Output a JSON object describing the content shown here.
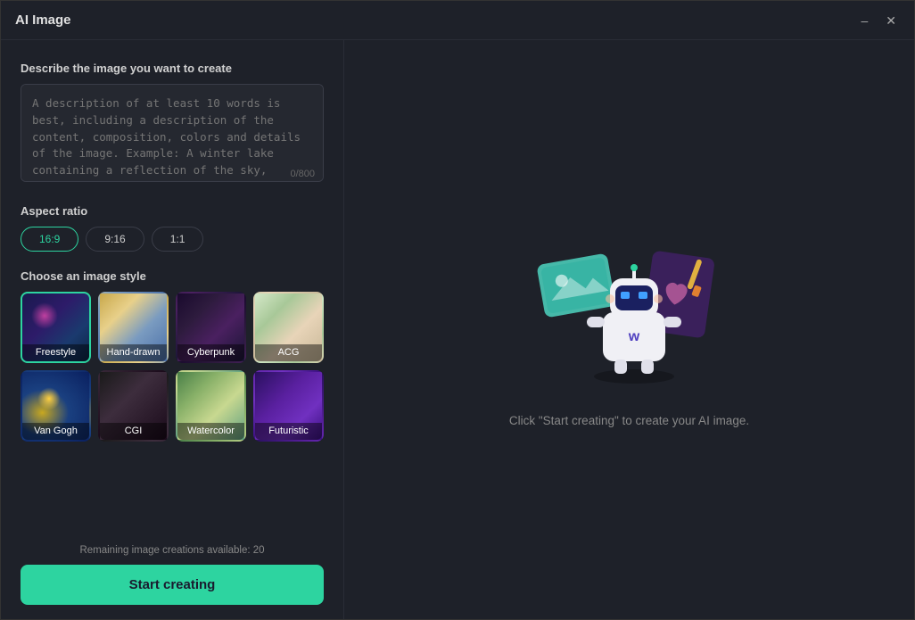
{
  "window": {
    "title": "AI Image",
    "minimize_label": "–",
    "close_label": "✕"
  },
  "left_panel": {
    "describe_label": "Describe the image you want to create",
    "textarea_placeholder": "A description of at least 10 words is best, including a description of the content, composition, colors and details of the image. Example: A winter lake containing a reflection of the sky, covered in white",
    "char_count": "0/800",
    "aspect_ratio_label": "Aspect ratio",
    "aspect_options": [
      {
        "id": "16_9",
        "label": "16:9",
        "active": true
      },
      {
        "id": "9_16",
        "label": "9:16",
        "active": false
      },
      {
        "id": "1_1",
        "label": "1:1",
        "active": false
      }
    ],
    "style_label": "Choose an image style",
    "styles": [
      {
        "id": "freestyle",
        "label": "Freestyle",
        "active": true,
        "class": "style-freestyle"
      },
      {
        "id": "hand_drawn",
        "label": "Hand-drawn",
        "active": false,
        "class": "style-handdrawn"
      },
      {
        "id": "cyberpunk",
        "label": "Cyberpunk",
        "active": false,
        "class": "style-cyberpunk"
      },
      {
        "id": "acg",
        "label": "ACG",
        "active": false,
        "class": "style-acg"
      },
      {
        "id": "van_gogh",
        "label": "Van Gogh",
        "active": false,
        "class": "style-vangogh"
      },
      {
        "id": "cgi",
        "label": "CGI",
        "active": false,
        "class": "style-cgi"
      },
      {
        "id": "watercolor",
        "label": "Watercolor",
        "active": false,
        "class": "style-watercolor"
      },
      {
        "id": "futuristic",
        "label": "Futuristic",
        "active": false,
        "class": "style-futuristic"
      }
    ],
    "remaining_text": "Remaining image creations available: 20",
    "start_btn_label": "Start creating"
  },
  "right_panel": {
    "prompt_text": "Click \"Start creating\" to create your AI image."
  },
  "colors": {
    "accent": "#2dd4a0",
    "bg": "#1e2129",
    "text_muted": "#888888"
  }
}
